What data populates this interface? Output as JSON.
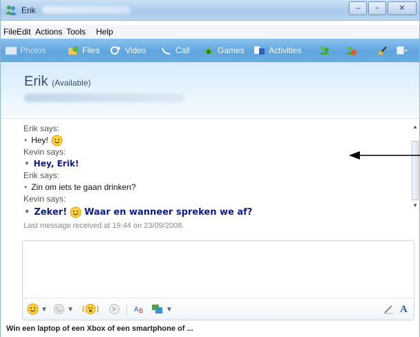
{
  "window": {
    "title": "Erik",
    "controls": {
      "minimize": "‒",
      "maximize": "▫",
      "close": "✕"
    }
  },
  "menu": [
    "File",
    "Edit",
    "Actions",
    "Tools",
    "Help"
  ],
  "toolbar": {
    "items": [
      {
        "label": "Photos",
        "icon": "photos-icon"
      },
      {
        "label": "Files",
        "icon": "files-icon"
      },
      {
        "label": "Video",
        "icon": "video-icon"
      },
      {
        "label": "Call",
        "icon": "call-icon"
      },
      {
        "label": "Games",
        "icon": "games-icon"
      },
      {
        "label": "Activities",
        "icon": "activities-icon"
      }
    ]
  },
  "header": {
    "contact_name": "Erik",
    "contact_status": "(Available)"
  },
  "conversation": {
    "messages": [
      {
        "sender_line": "Erik says:",
        "text": "Hey!",
        "style": "erik",
        "smiley": "after"
      },
      {
        "sender_line": "Kevin says:",
        "text": "Hey, Erik!",
        "style": "kevin"
      },
      {
        "sender_line": "Erik says:",
        "text": "Zin om iets te gaan drinken?",
        "style": "erik"
      },
      {
        "sender_line": "Kevin says:",
        "text_before": "Zeker!",
        "text_after": "Waar en wanneer spreken we af?",
        "style": "kevin"
      }
    ],
    "last_message": "Last message received at 19:44 on 23/09/2008."
  },
  "compose": {
    "text": "",
    "font_button": "A"
  },
  "ad": {
    "text": "Win een laptop of een Xbox of een smartphone of ..."
  },
  "colors": {
    "toolbar": "#6aaee2",
    "kevin_text": "#0c1b8a",
    "header_bg": "#e4f2fc"
  }
}
